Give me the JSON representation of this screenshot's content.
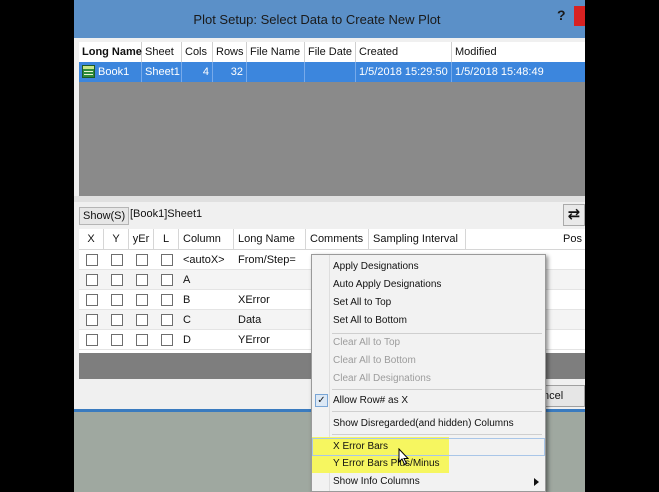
{
  "dialog": {
    "title": "Plot Setup: Select Data to Create New Plot",
    "help_label": "?"
  },
  "book_table": {
    "headers": [
      "Long Name",
      "Sheet",
      "Cols",
      "Rows",
      "File Name",
      "File Date",
      "Created",
      "Modified"
    ],
    "rows": [
      {
        "long_name": "Book1",
        "sheet": "Sheet1",
        "cols": "4",
        "rows": "32",
        "file_name": "",
        "file_date": "",
        "created": "1/5/2018 15:29:50",
        "modified": "1/5/2018 15:48:49"
      }
    ]
  },
  "show_bar": {
    "show_button": "Show(S)",
    "path": "[Book1]Sheet1",
    "swap_icon": "⇄"
  },
  "column_table": {
    "headers": [
      "X",
      "Y",
      "yEr",
      "L",
      "Column",
      "Long Name",
      "Comments",
      "Sampling Interval",
      "Pos"
    ],
    "rows": [
      {
        "column": "<autoX>",
        "long_name": "From/Step="
      },
      {
        "column": "A",
        "long_name": ""
      },
      {
        "column": "B",
        "long_name": "XError"
      },
      {
        "column": "C",
        "long_name": "Data"
      },
      {
        "column": "D",
        "long_name": "YError"
      }
    ]
  },
  "footer": {
    "cancel_label": "ncel"
  },
  "context_menu": {
    "group1": [
      "Apply Designations",
      "Auto Apply Designations",
      "Set All to Top",
      "Set All to Bottom"
    ],
    "group2": [
      "Clear All to Top",
      "Clear All to Bottom",
      "Clear All Designations"
    ],
    "allow_row": {
      "label": "Allow Row# as X",
      "checked": true
    },
    "show_disregarded": "Show Disregarded(and hidden) Columns",
    "x_error_bars": "X Error Bars",
    "y_error_bars": "Y Error Bars Plus/Minus",
    "show_info_columns": "Show Info Columns",
    "highlight_color": "#f6f660"
  },
  "colors": {
    "title_bar": "#5b90c8",
    "selection": "#3c86dd",
    "close_button": "#d82222"
  }
}
